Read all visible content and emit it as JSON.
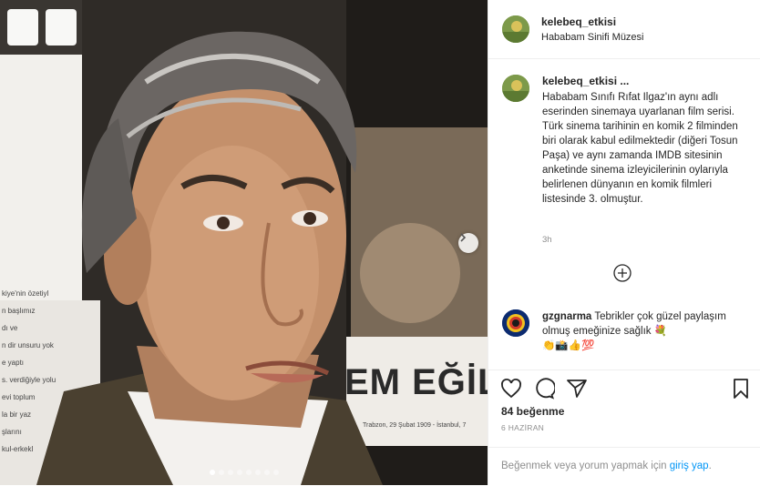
{
  "post": {
    "username": "kelebeq_etkisi",
    "location": "Hababam Sinifi Müzesi",
    "caption_username": "kelebeq_etkisi ...",
    "caption": "Hababam Sınıfı Rıfat Ilgaz'ın aynı adlı eserinden sinemaya uyarlanan film serisi. Türk sinema tarihinin en komik 2 filminden biri olarak kabul edilmektedir (diğeri Tosun Paşa) ve aynı zamanda IMDB sitesinin anketinde sinema izleyicilerinin oylarıyla belirlenen dünyanın en komik filmleri listesinde 3. olmuştur.",
    "caption_time": "3h"
  },
  "media": {
    "background_text": "EM EĞİL",
    "side_texts": [
      "kiye'nin özetiyl",
      "n başlımız",
      "dı ve",
      "n dir unsuru yok",
      "e yaptı",
      "s. verdiğiyle yolu",
      "evi toplum",
      "la bir yaz",
      "şlarını",
      "kul-erkekl"
    ],
    "small_footer": "Trabzon, 29 Şubat 1909 - İstanbul, 7",
    "slide_count": 8,
    "active_slide": 0
  },
  "comment": {
    "username": "gzgnarma",
    "text": "Tebrikler çok güzel paylaşım olmuş emeğinize sağlık 💐",
    "emojis": "👏📸👍💯"
  },
  "actions": {
    "likes": "84 beğenme",
    "date": "6 HAZİRAN"
  },
  "login_prompt": {
    "text": "Beğenmek veya yorum yapmak için",
    "link": "giriş yap",
    "end": "."
  }
}
